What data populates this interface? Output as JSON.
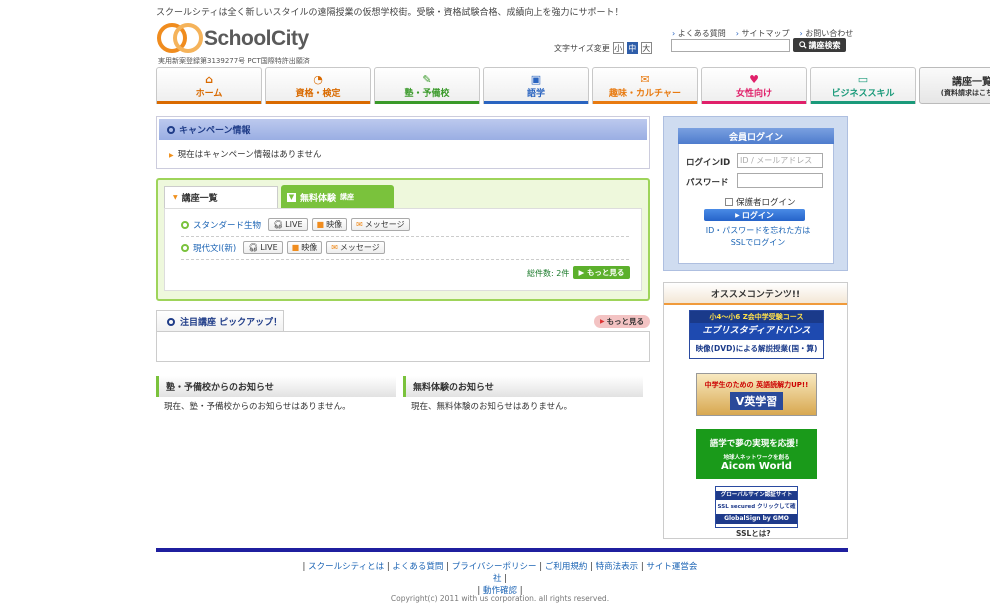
{
  "header": {
    "tagline": "スクールシティは全く新しいスタイルの遠隔授業の仮想学校街。受験・資格試験合格、成績向上を強力にサポート！",
    "logo_text": "SchoolCity",
    "license": "実用新案登録第3139277号 PCT国際特許出願済",
    "font_size_label": "文字サイズ変更",
    "font_sizes": [
      "小",
      "中",
      "大"
    ],
    "font_size_active": "中",
    "top_links": [
      "よくある質問",
      "サイトマップ",
      "お問い合わせ"
    ],
    "search_button": "講座検索"
  },
  "nav": {
    "items": [
      {
        "label": "ホーム",
        "icon": "home-icon",
        "color": "#d96a00",
        "glyph": "⌂"
      },
      {
        "label": "資格・検定",
        "icon": "clock-icon",
        "color": "#d96a00",
        "glyph": "◔"
      },
      {
        "label": "塾・予備校",
        "icon": "pencil-icon",
        "color": "#3a9a2a",
        "glyph": "✎"
      },
      {
        "label": "語学",
        "icon": "book-icon",
        "color": "#2a64c0",
        "glyph": "▣"
      },
      {
        "label": "趣味・カルチャー",
        "icon": "mail-icon",
        "color": "#e87a10",
        "glyph": "✉"
      },
      {
        "label": "女性向け",
        "icon": "heart-icon",
        "color": "#e0206a",
        "glyph": "♥"
      },
      {
        "label": "ビジネススキル",
        "icon": "computer-icon",
        "color": "#1a9a7a",
        "glyph": "▭"
      }
    ],
    "last": {
      "title": "講座一覧",
      "sub": "(資料請求はこちら)"
    }
  },
  "campaign": {
    "title": "キャンペーン情報",
    "message": "現在はキャンペーン情報はありません"
  },
  "courses": {
    "tab_list": "講座一覧",
    "tab_trial": "無料体験",
    "tab_trial_suffix": "講座",
    "rows": [
      {
        "name": "スタンダード生物",
        "buttons": [
          "LIVE",
          "映像",
          "メッセージ"
        ]
      },
      {
        "name": "現代文Ⅰ(新)",
        "buttons": [
          "LIVE",
          "映像",
          "メッセージ"
        ]
      }
    ],
    "count": "総件数: 2件",
    "more": "もっと見る"
  },
  "pickup": {
    "title": "注目講座 ピックアップ！",
    "more": "もっと見る"
  },
  "news": [
    {
      "title": "塾・予備校からのお知らせ",
      "body": "現在、塾・予備校からのお知らせはありません。"
    },
    {
      "title": "無料体験のお知らせ",
      "body": "現在、無料体験のお知らせはありません。"
    }
  ],
  "login": {
    "title": "会員ログイン",
    "id_label": "ログインID",
    "id_placeholder": "ID / メールアドレス",
    "pw_label": "パスワード",
    "guardian": "保護者ログイン",
    "button": "ログイン",
    "forgot": "ID・パスワードを忘れた方は",
    "ssl_login": "SSLでログイン"
  },
  "recommend": {
    "title": "オススメコンテンツ!!",
    "banners": [
      {
        "line1": "小4～小6 Z会中学受験コース",
        "line2": "エブリスタディアドバンス",
        "line3": "映像(DVD)による解説授業(国・算)"
      },
      {
        "line1": "中学生のための 英語読解力UP!!",
        "line2": "V英学習"
      },
      {
        "line1": "語学で夢の実現を応援！",
        "line2": "地球人ネットワークを創る",
        "line3": "Aicom World"
      },
      {
        "line1": "グローバルサイン認証サイト",
        "line2": "SSL secured クリックして確認",
        "line3": "GlobalSign by GMO",
        "caption": "SSLとは?"
      }
    ]
  },
  "footer": {
    "links": [
      "スクールシティとは",
      "よくある質問",
      "プライバシーポリシー",
      "ご利用規約",
      "特商法表示",
      "サイト運営会社"
    ],
    "links2": [
      "動作確認"
    ],
    "copyright": "Copyright(c) 2011 with us corporation. all rights reserved."
  }
}
